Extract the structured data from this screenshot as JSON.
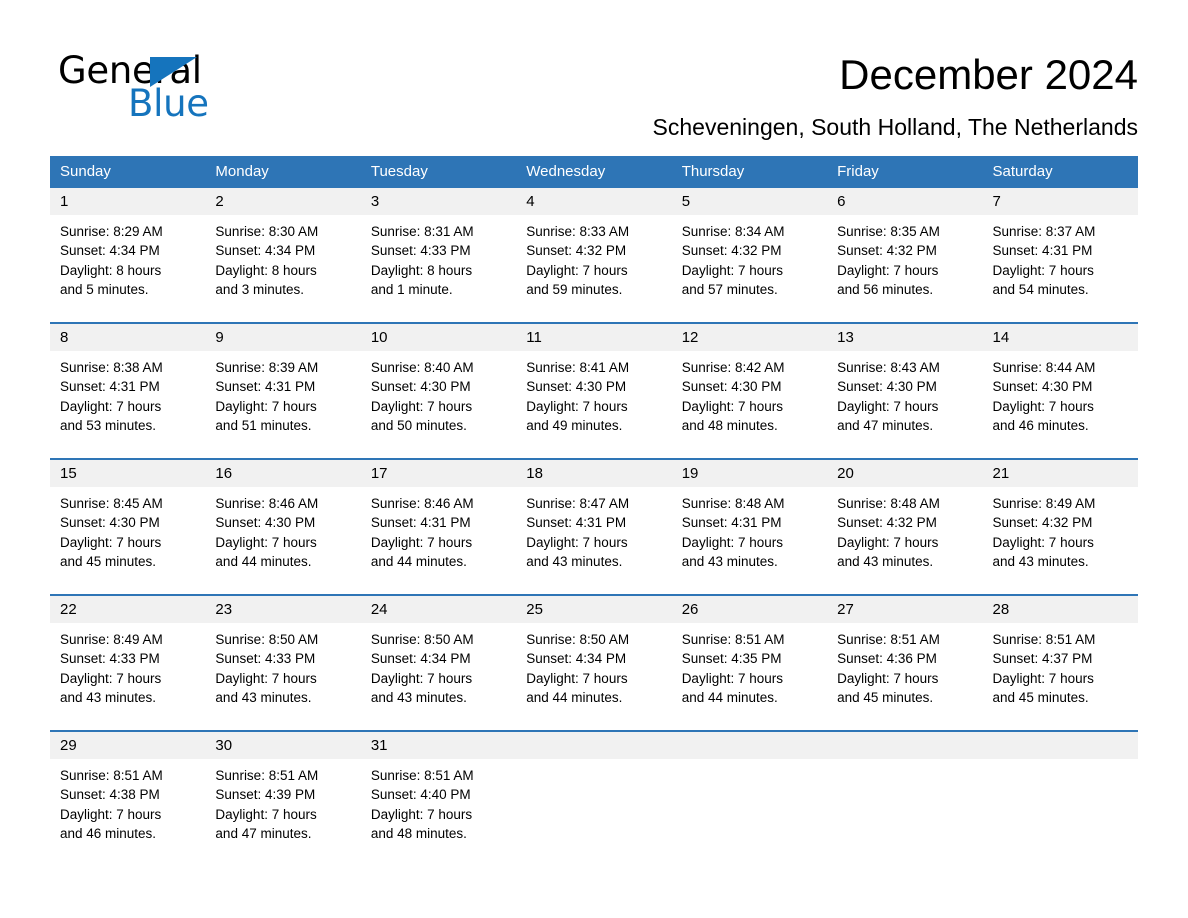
{
  "brand": {
    "name_part1": "General",
    "name_part2": "Blue",
    "triangle_icon": "brand-triangle-icon",
    "colors": {
      "black": "#000000",
      "blue": "#1574bd"
    }
  },
  "header": {
    "title": "December 2024",
    "subtitle": "Scheveningen, South Holland, The Netherlands"
  },
  "calendar": {
    "accent_color": "#2e75b6",
    "day_band_color": "#f1f1f1",
    "weekdays": [
      "Sunday",
      "Monday",
      "Tuesday",
      "Wednesday",
      "Thursday",
      "Friday",
      "Saturday"
    ],
    "weeks": [
      [
        {
          "day": "1",
          "sunrise": "Sunrise: 8:29 AM",
          "sunset": "Sunset: 4:34 PM",
          "daylight_line1": "Daylight: 8 hours",
          "daylight_line2": "and 5 minutes."
        },
        {
          "day": "2",
          "sunrise": "Sunrise: 8:30 AM",
          "sunset": "Sunset: 4:34 PM",
          "daylight_line1": "Daylight: 8 hours",
          "daylight_line2": "and 3 minutes."
        },
        {
          "day": "3",
          "sunrise": "Sunrise: 8:31 AM",
          "sunset": "Sunset: 4:33 PM",
          "daylight_line1": "Daylight: 8 hours",
          "daylight_line2": "and 1 minute."
        },
        {
          "day": "4",
          "sunrise": "Sunrise: 8:33 AM",
          "sunset": "Sunset: 4:32 PM",
          "daylight_line1": "Daylight: 7 hours",
          "daylight_line2": "and 59 minutes."
        },
        {
          "day": "5",
          "sunrise": "Sunrise: 8:34 AM",
          "sunset": "Sunset: 4:32 PM",
          "daylight_line1": "Daylight: 7 hours",
          "daylight_line2": "and 57 minutes."
        },
        {
          "day": "6",
          "sunrise": "Sunrise: 8:35 AM",
          "sunset": "Sunset: 4:32 PM",
          "daylight_line1": "Daylight: 7 hours",
          "daylight_line2": "and 56 minutes."
        },
        {
          "day": "7",
          "sunrise": "Sunrise: 8:37 AM",
          "sunset": "Sunset: 4:31 PM",
          "daylight_line1": "Daylight: 7 hours",
          "daylight_line2": "and 54 minutes."
        }
      ],
      [
        {
          "day": "8",
          "sunrise": "Sunrise: 8:38 AM",
          "sunset": "Sunset: 4:31 PM",
          "daylight_line1": "Daylight: 7 hours",
          "daylight_line2": "and 53 minutes."
        },
        {
          "day": "9",
          "sunrise": "Sunrise: 8:39 AM",
          "sunset": "Sunset: 4:31 PM",
          "daylight_line1": "Daylight: 7 hours",
          "daylight_line2": "and 51 minutes."
        },
        {
          "day": "10",
          "sunrise": "Sunrise: 8:40 AM",
          "sunset": "Sunset: 4:30 PM",
          "daylight_line1": "Daylight: 7 hours",
          "daylight_line2": "and 50 minutes."
        },
        {
          "day": "11",
          "sunrise": "Sunrise: 8:41 AM",
          "sunset": "Sunset: 4:30 PM",
          "daylight_line1": "Daylight: 7 hours",
          "daylight_line2": "and 49 minutes."
        },
        {
          "day": "12",
          "sunrise": "Sunrise: 8:42 AM",
          "sunset": "Sunset: 4:30 PM",
          "daylight_line1": "Daylight: 7 hours",
          "daylight_line2": "and 48 minutes."
        },
        {
          "day": "13",
          "sunrise": "Sunrise: 8:43 AM",
          "sunset": "Sunset: 4:30 PM",
          "daylight_line1": "Daylight: 7 hours",
          "daylight_line2": "and 47 minutes."
        },
        {
          "day": "14",
          "sunrise": "Sunrise: 8:44 AM",
          "sunset": "Sunset: 4:30 PM",
          "daylight_line1": "Daylight: 7 hours",
          "daylight_line2": "and 46 minutes."
        }
      ],
      [
        {
          "day": "15",
          "sunrise": "Sunrise: 8:45 AM",
          "sunset": "Sunset: 4:30 PM",
          "daylight_line1": "Daylight: 7 hours",
          "daylight_line2": "and 45 minutes."
        },
        {
          "day": "16",
          "sunrise": "Sunrise: 8:46 AM",
          "sunset": "Sunset: 4:30 PM",
          "daylight_line1": "Daylight: 7 hours",
          "daylight_line2": "and 44 minutes."
        },
        {
          "day": "17",
          "sunrise": "Sunrise: 8:46 AM",
          "sunset": "Sunset: 4:31 PM",
          "daylight_line1": "Daylight: 7 hours",
          "daylight_line2": "and 44 minutes."
        },
        {
          "day": "18",
          "sunrise": "Sunrise: 8:47 AM",
          "sunset": "Sunset: 4:31 PM",
          "daylight_line1": "Daylight: 7 hours",
          "daylight_line2": "and 43 minutes."
        },
        {
          "day": "19",
          "sunrise": "Sunrise: 8:48 AM",
          "sunset": "Sunset: 4:31 PM",
          "daylight_line1": "Daylight: 7 hours",
          "daylight_line2": "and 43 minutes."
        },
        {
          "day": "20",
          "sunrise": "Sunrise: 8:48 AM",
          "sunset": "Sunset: 4:32 PM",
          "daylight_line1": "Daylight: 7 hours",
          "daylight_line2": "and 43 minutes."
        },
        {
          "day": "21",
          "sunrise": "Sunrise: 8:49 AM",
          "sunset": "Sunset: 4:32 PM",
          "daylight_line1": "Daylight: 7 hours",
          "daylight_line2": "and 43 minutes."
        }
      ],
      [
        {
          "day": "22",
          "sunrise": "Sunrise: 8:49 AM",
          "sunset": "Sunset: 4:33 PM",
          "daylight_line1": "Daylight: 7 hours",
          "daylight_line2": "and 43 minutes."
        },
        {
          "day": "23",
          "sunrise": "Sunrise: 8:50 AM",
          "sunset": "Sunset: 4:33 PM",
          "daylight_line1": "Daylight: 7 hours",
          "daylight_line2": "and 43 minutes."
        },
        {
          "day": "24",
          "sunrise": "Sunrise: 8:50 AM",
          "sunset": "Sunset: 4:34 PM",
          "daylight_line1": "Daylight: 7 hours",
          "daylight_line2": "and 43 minutes."
        },
        {
          "day": "25",
          "sunrise": "Sunrise: 8:50 AM",
          "sunset": "Sunset: 4:34 PM",
          "daylight_line1": "Daylight: 7 hours",
          "daylight_line2": "and 44 minutes."
        },
        {
          "day": "26",
          "sunrise": "Sunrise: 8:51 AM",
          "sunset": "Sunset: 4:35 PM",
          "daylight_line1": "Daylight: 7 hours",
          "daylight_line2": "and 44 minutes."
        },
        {
          "day": "27",
          "sunrise": "Sunrise: 8:51 AM",
          "sunset": "Sunset: 4:36 PM",
          "daylight_line1": "Daylight: 7 hours",
          "daylight_line2": "and 45 minutes."
        },
        {
          "day": "28",
          "sunrise": "Sunrise: 8:51 AM",
          "sunset": "Sunset: 4:37 PM",
          "daylight_line1": "Daylight: 7 hours",
          "daylight_line2": "and 45 minutes."
        }
      ],
      [
        {
          "day": "29",
          "sunrise": "Sunrise: 8:51 AM",
          "sunset": "Sunset: 4:38 PM",
          "daylight_line1": "Daylight: 7 hours",
          "daylight_line2": "and 46 minutes."
        },
        {
          "day": "30",
          "sunrise": "Sunrise: 8:51 AM",
          "sunset": "Sunset: 4:39 PM",
          "daylight_line1": "Daylight: 7 hours",
          "daylight_line2": "and 47 minutes."
        },
        {
          "day": "31",
          "sunrise": "Sunrise: 8:51 AM",
          "sunset": "Sunset: 4:40 PM",
          "daylight_line1": "Daylight: 7 hours",
          "daylight_line2": "and 48 minutes."
        },
        {
          "day": "",
          "sunrise": "",
          "sunset": "",
          "daylight_line1": "",
          "daylight_line2": ""
        },
        {
          "day": "",
          "sunrise": "",
          "sunset": "",
          "daylight_line1": "",
          "daylight_line2": ""
        },
        {
          "day": "",
          "sunrise": "",
          "sunset": "",
          "daylight_line1": "",
          "daylight_line2": ""
        },
        {
          "day": "",
          "sunrise": "",
          "sunset": "",
          "daylight_line1": "",
          "daylight_line2": ""
        }
      ]
    ]
  }
}
